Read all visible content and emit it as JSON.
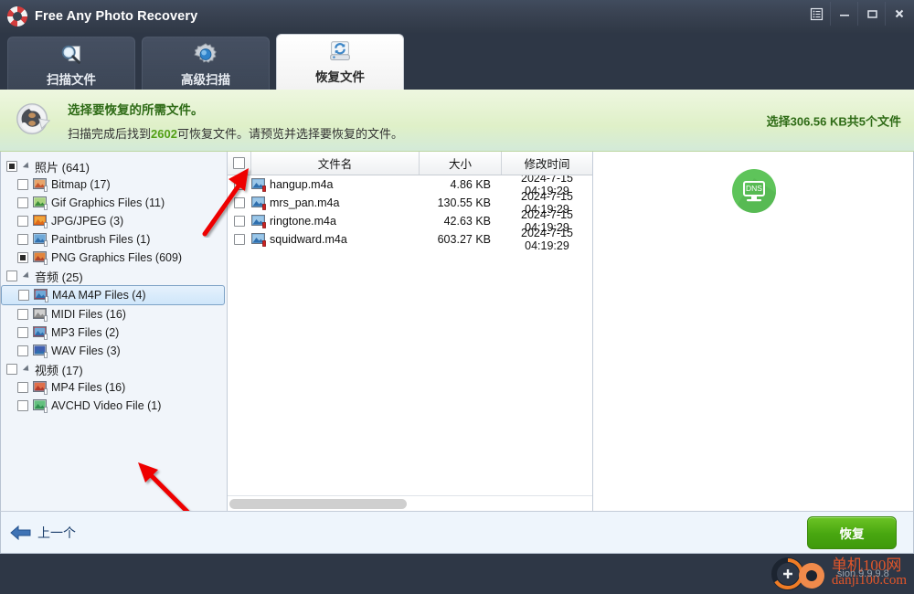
{
  "window": {
    "app_title": "Free Any Photo Recovery",
    "logo_icon": "lifebuoy-icon",
    "controls": [
      {
        "name": "menu-button",
        "icon": "list-menu-icon",
        "label": ""
      },
      {
        "name": "minimize-button",
        "icon": "minimize-icon",
        "label": ""
      },
      {
        "name": "maximize-button",
        "icon": "maximize-icon",
        "label": ""
      },
      {
        "name": "close-button",
        "icon": "close-icon",
        "label": "X"
      }
    ]
  },
  "tabs": [
    {
      "label": "扫描文件",
      "icon": "magnifier-document-icon",
      "active": false
    },
    {
      "label": "高级扫描",
      "icon": "gear-icon",
      "active": false
    },
    {
      "label": "恢复文件",
      "icon": "recover-drive-icon",
      "active": true
    }
  ],
  "banner": {
    "icon": "recover-arrow-icon",
    "title": "选择要恢复的所需文件。",
    "desc_before": "扫描完成后找到",
    "desc_highlight": "2602",
    "desc_after": "可恢复文件。请预览并选择要恢复的文件。",
    "selection_status": "选择306.56 KB共5个文件",
    "highlight_color": "#53a017",
    "title_color": "#2e6b16"
  },
  "sidebar": {
    "items": [
      {
        "label": "照片 (641)",
        "level": 0,
        "checkbox": "filled",
        "expander": true,
        "icon": "",
        "selected": false
      },
      {
        "label": "Bitmap (17)",
        "level": 1,
        "checkbox": "empty",
        "expander": false,
        "icon": "bitmap-file-icon",
        "selected": false
      },
      {
        "label": "Gif Graphics Files (11)",
        "level": 1,
        "checkbox": "empty",
        "expander": false,
        "icon": "gif-file-icon",
        "selected": false
      },
      {
        "label": "JPG/JPEG (3)",
        "level": 1,
        "checkbox": "empty",
        "expander": false,
        "icon": "jpeg-file-icon",
        "selected": false
      },
      {
        "label": "Paintbrush Files (1)",
        "level": 1,
        "checkbox": "empty",
        "expander": false,
        "icon": "paintbrush-file-icon",
        "selected": false
      },
      {
        "label": "PNG Graphics Files (609)",
        "level": 1,
        "checkbox": "filled",
        "expander": false,
        "icon": "png-file-icon",
        "selected": false
      },
      {
        "label": "音频 (25)",
        "level": 0,
        "checkbox": "empty",
        "expander": true,
        "icon": "",
        "selected": false
      },
      {
        "label": "M4A M4P Files (4)",
        "level": 1,
        "checkbox": "empty",
        "expander": false,
        "icon": "audio-file-icon",
        "selected": true
      },
      {
        "label": "MIDI Files (16)",
        "level": 1,
        "checkbox": "empty",
        "expander": false,
        "icon": "midi-file-icon",
        "selected": false
      },
      {
        "label": "MP3 Files (2)",
        "level": 1,
        "checkbox": "empty",
        "expander": false,
        "icon": "mp3-file-icon",
        "selected": false
      },
      {
        "label": "WAV Files (3)",
        "level": 1,
        "checkbox": "empty",
        "expander": false,
        "icon": "wav-file-icon",
        "selected": false
      },
      {
        "label": "视频 (17)",
        "level": 0,
        "checkbox": "empty",
        "expander": true,
        "icon": "",
        "selected": false
      },
      {
        "label": "MP4 Files (16)",
        "level": 1,
        "checkbox": "empty",
        "expander": false,
        "icon": "mp4-file-icon",
        "selected": false
      },
      {
        "label": "AVCHD Video File (1)",
        "level": 1,
        "checkbox": "empty",
        "expander": false,
        "icon": "avchd-file-icon",
        "selected": false
      }
    ]
  },
  "filelist": {
    "columns": [
      {
        "key": "check",
        "label": ""
      },
      {
        "key": "name",
        "label": "文件名"
      },
      {
        "key": "size",
        "label": "大小"
      },
      {
        "key": "modified",
        "label": "修改时间"
      }
    ],
    "rows": [
      {
        "name": "hangup.m4a",
        "size": "4.86 KB",
        "modified": "2024-7-15 04:19:29",
        "checked": false,
        "icon": "audio-file-icon"
      },
      {
        "name": "mrs_pan.m4a",
        "size": "130.55 KB",
        "modified": "2024-7-15 04:19:29",
        "checked": false,
        "icon": "audio-file-icon"
      },
      {
        "name": "ringtone.m4a",
        "size": "42.63 KB",
        "modified": "2024-7-15 04:19:29",
        "checked": false,
        "icon": "audio-file-icon"
      },
      {
        "name": "squidward.m4a",
        "size": "603.27 KB",
        "modified": "2024-7-15 04:19:29",
        "checked": false,
        "icon": "audio-file-icon"
      }
    ]
  },
  "preview": {
    "badge_label": "DNS",
    "badge_icon": "monitor-icon",
    "badge_color": "#5ec45a"
  },
  "footer": {
    "back_label": "上一个",
    "back_icon": "arrow-left-icon",
    "recover_label": "恢复",
    "recover_color": "#48a610"
  },
  "watermark": {
    "line_cn": "单机100网",
    "line_en": "danji100.com",
    "version": "sion 9.9.9.8",
    "color": "#e2562a"
  }
}
